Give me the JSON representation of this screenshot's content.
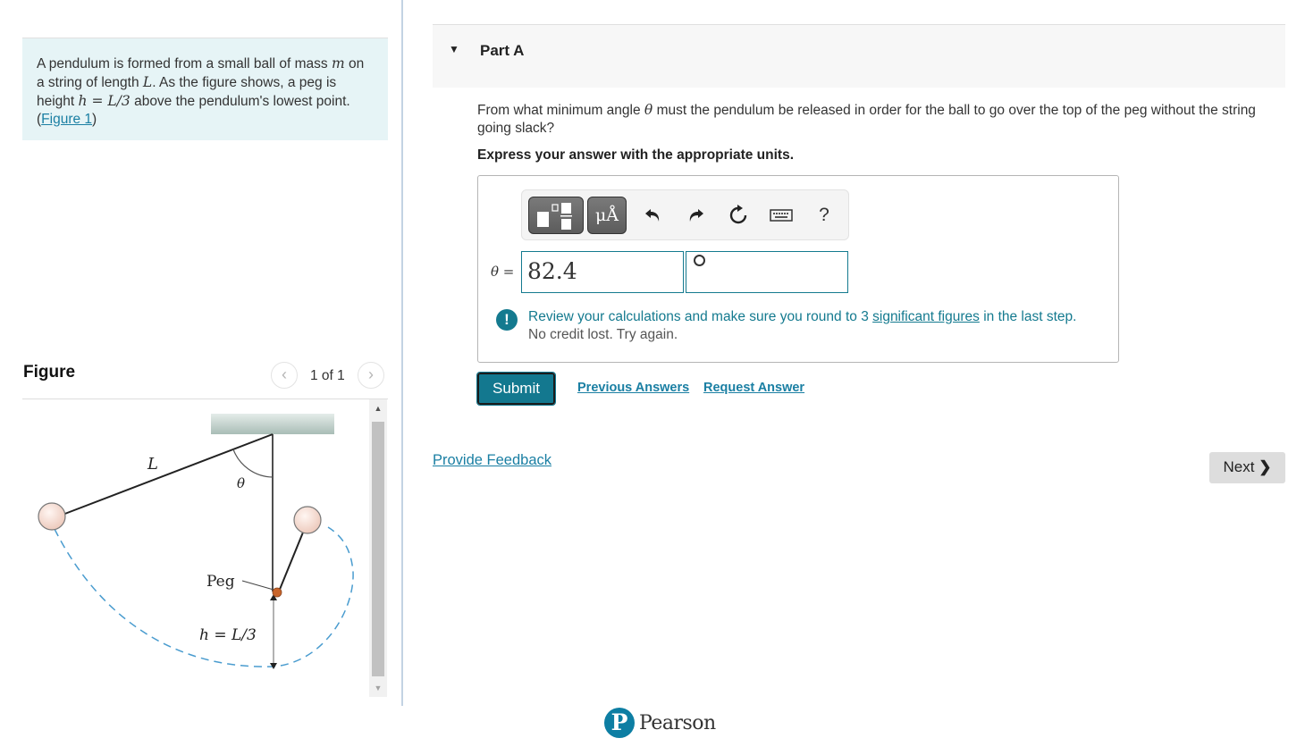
{
  "problem": {
    "intro_parts": {
      "t1": "A pendulum is formed from a small ball of mass ",
      "m": "m",
      "t2": " on a string of length ",
      "L": "L",
      "t3": ". As the figure shows, a peg is height ",
      "h": "h",
      "eq": " = ",
      "ratio": "L/3",
      "t4": " above the pendulum's lowest point. (",
      "figure_link": "Figure 1",
      "t5": ")"
    }
  },
  "figure_panel": {
    "title": "Figure",
    "pager": "1 of 1",
    "prev_icon": "‹",
    "next_icon": "›",
    "labels": {
      "length": "L",
      "angle": "θ",
      "peg": "Peg",
      "height": "h = L/3"
    },
    "colors": {
      "ball": "#f6ddd4",
      "peg": "#c8652b",
      "path": "#4a9ccf",
      "ceiling": "#b7c9c3"
    }
  },
  "part_a": {
    "caret": "▼",
    "title": "Part A",
    "question_pre": "From what minimum angle ",
    "question_var": "θ",
    "question_post": " must the pendulum be released in order for the ball to go over the top of the peg without the string going slack?",
    "instruction": "Express your answer with the appropriate units.",
    "toolbar": {
      "templates_icon": "templates-icon",
      "units_label": "μÅ",
      "help_label": "?"
    },
    "answer": {
      "variable_label": "θ =",
      "value": "82.4",
      "unit": "°"
    },
    "feedback": {
      "icon": "!",
      "line1_pre": "Review your calculations and make sure you round to 3 ",
      "line1_link": "significant figures",
      "line1_post": " in the last step.",
      "line2": "No credit lost. Try again."
    },
    "buttons": {
      "submit": "Submit",
      "previous_answers": "Previous Answers",
      "request_answer": "Request Answer"
    }
  },
  "footer": {
    "provide_feedback": "Provide Feedback",
    "next": "Next",
    "next_chevron": "❯",
    "brand_logo": "P",
    "brand": "Pearson"
  },
  "colors": {
    "accent": "#147a8f",
    "link": "#1a7fa3",
    "intro_bg": "#e6f4f6",
    "part_header_bg": "#f7f7f7"
  }
}
